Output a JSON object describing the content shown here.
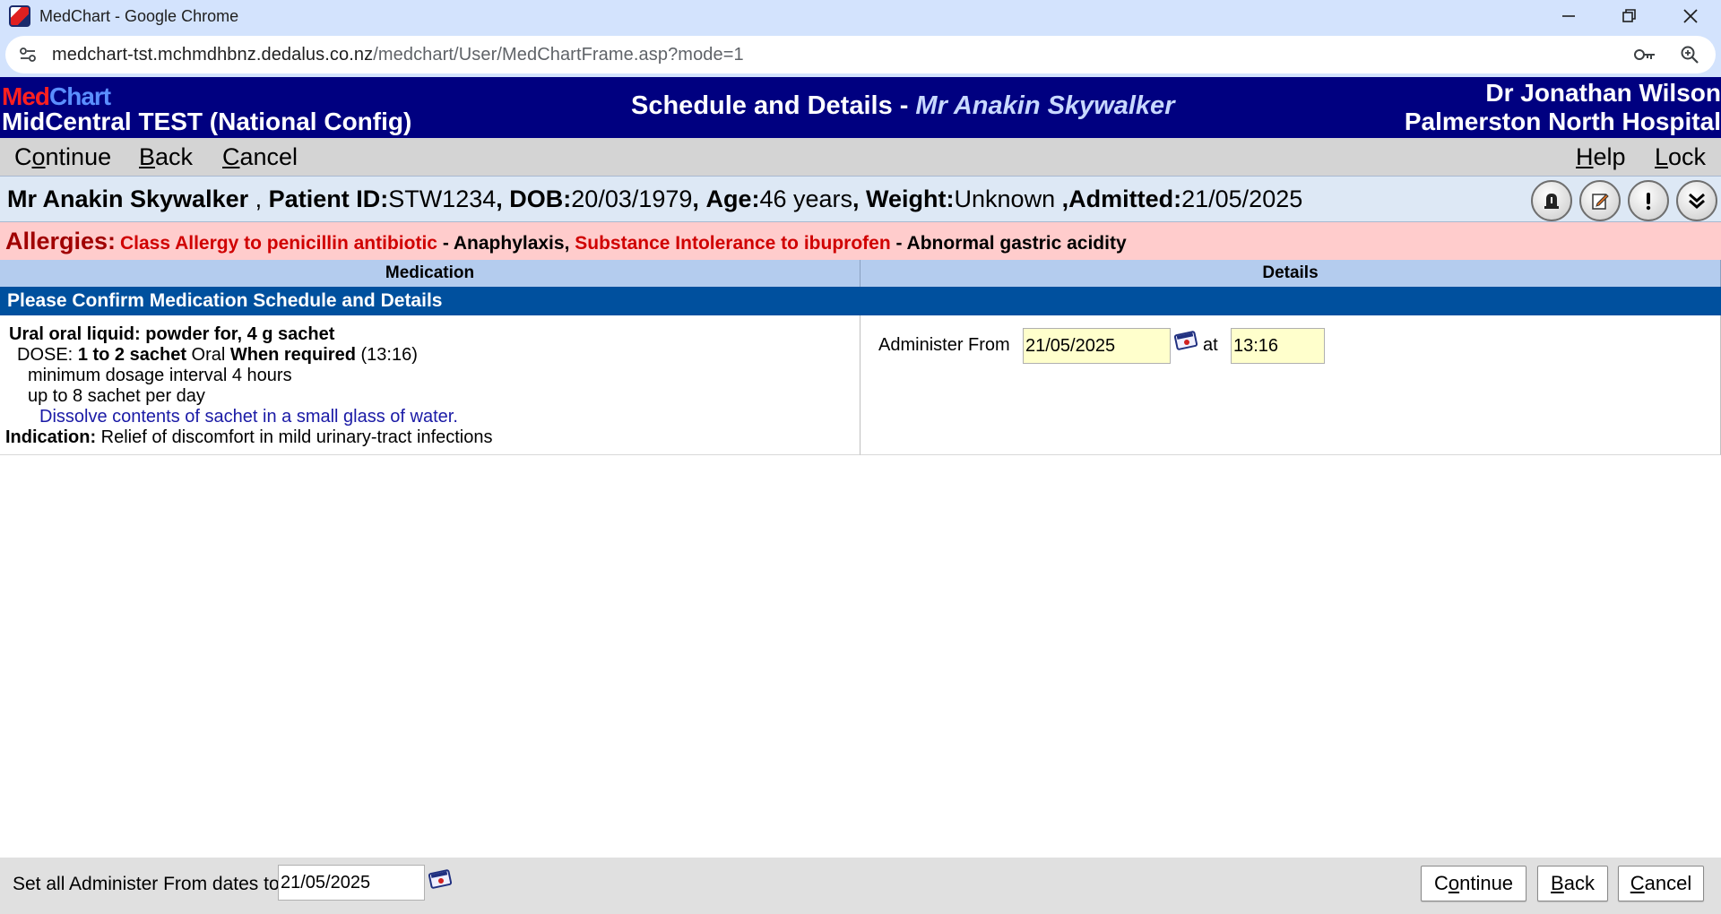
{
  "browser": {
    "window_title": "MedChart - Google Chrome",
    "url_host": "medchart-tst.mchmdhbnz.dedalus.co.nz",
    "url_path": "/medchart/User/MedChartFrame.asp?mode=1"
  },
  "header": {
    "logo_med": "Med",
    "logo_chart": "Chart",
    "site": "MidCentral TEST (National Config)",
    "title": "Schedule and Details -",
    "patient_name": "Mr Anakin Skywalker",
    "doctor": "Dr Jonathan Wilson",
    "hospital": "Palmerston North Hospital"
  },
  "menu": {
    "continue": {
      "key": "o",
      "pre": "C",
      "post": "ntinue"
    },
    "back": {
      "key": "B",
      "pre": "",
      "post": "ack"
    },
    "cancel": {
      "key": "C",
      "pre": "",
      "post": "ancel"
    },
    "help": {
      "key": "H",
      "pre": "",
      "post": "elp"
    },
    "lock": {
      "key": "L",
      "pre": "",
      "post": "ock"
    }
  },
  "patient": {
    "name": "Mr Anakin Skywalker",
    "sep": ",",
    "id_label": "Patient ID:",
    "id": "STW1234",
    "dob_label": "DOB:",
    "dob": "20/03/1979",
    "age_label": "Age:",
    "age": "46 years",
    "weight_label": "Weight:",
    "weight": "Unknown",
    "admitted_label": "Admitted:",
    "admitted": "21/05/2025"
  },
  "allergies": {
    "label": "Allergies:",
    "a1": "Class Allergy to penicillin antibiotic",
    "r1": "- Anaphylaxis",
    "comma": ",",
    "a2": "Substance Intolerance to ibuprofen",
    "r2": "- Abnormal gastric acidity"
  },
  "table": {
    "col_medication": "Medication",
    "col_details": "Details",
    "section": "Please Confirm Medication Schedule and Details"
  },
  "medication": {
    "name": "Ural oral liquid: powder for, 4 g sachet",
    "dose_label": "DOSE:",
    "dose": "1 to 2 sachet",
    "route": "Oral",
    "freq": "When required",
    "time": "(13:16)",
    "interval": "minimum dosage interval 4 hours",
    "max": "up to 8 sachet per day",
    "instructions": "Dissolve contents of sachet in a small glass of water.",
    "indication_label": "Indication:",
    "indication": "Relief of discomfort in mild urinary-tract infections"
  },
  "details": {
    "administer_from_label": "Administer From",
    "date": "21/05/2025",
    "at_label": "at",
    "time": "13:16"
  },
  "footer": {
    "set_all_label": "Set all Administer From dates to",
    "date": "21/05/2025",
    "continue": {
      "key": "o",
      "pre": "C",
      "post": "ntinue"
    },
    "back": {
      "key": "B",
      "pre": "",
      "post": "ack"
    },
    "cancel": {
      "key": "C",
      "pre": "",
      "post": "ancel"
    }
  }
}
